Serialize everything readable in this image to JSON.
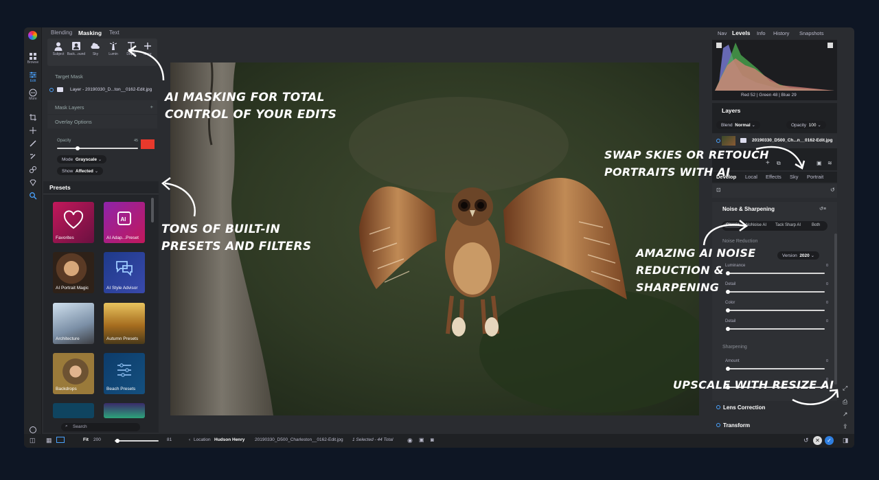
{
  "left_tabs": [
    "Blending",
    "Masking",
    "Text"
  ],
  "rail": {
    "browse": "Browse",
    "edit": "Edit",
    "more": "More"
  },
  "mask_tools": [
    "Subject",
    "Back...ound",
    "Sky",
    "Lumin",
    "Depth",
    "More"
  ],
  "target_mask": {
    "label": "Target Mask",
    "layer": "Layer - 20190330_D...ton__0162-Edit.jpg"
  },
  "mask_layers": "Mask Layers",
  "overlay_options": "Overlay Options",
  "opacity": {
    "label": "Opacity",
    "value": "45",
    "level": 0.45,
    "color": "#e8392c"
  },
  "mode": {
    "label": "Mode",
    "value": "Grayscale"
  },
  "show": {
    "label": "Show",
    "value": "Affected"
  },
  "presets": {
    "title": "Presets",
    "tiles": [
      "Favorites",
      "AI Adap...Preset",
      "AI Portrait Magic",
      "AI Style Advisor",
      "Architecture",
      "Autumn Presets",
      "Backdrops",
      "Beach Presets"
    ],
    "search_placeholder": "Search"
  },
  "right_tabs": [
    "Nav",
    "Levels",
    "Info",
    "History",
    "Snapshots"
  ],
  "histogram_readout": "Red  52  | Green  48  | Blue  29",
  "layers": {
    "title": "Layers",
    "blend_label": "Blend",
    "blend_value": "Normal",
    "opacity_label": "Opacity",
    "opacity_value": "100",
    "layer_name": "20190330_D500_Ch...n__0162-Edit.jpg"
  },
  "develop_tabs": [
    "Develop",
    "Local",
    "Effects",
    "Sky",
    "Portrait"
  ],
  "noise": {
    "title": "Noise & Sharpening",
    "modes": [
      "Classic",
      "NoNoise AI",
      "Tack Sharp AI",
      "Both"
    ],
    "reduction": "Noise Reduction",
    "version_label": "Version",
    "version": "2020",
    "sliders": [
      {
        "label": "Luminance",
        "value": "0"
      },
      {
        "label": "Detail",
        "value": "0"
      },
      {
        "label": "Color",
        "value": "0"
      },
      {
        "label": "Detail",
        "value": "0"
      }
    ],
    "sharpening": "Sharpening",
    "sharp_sliders": [
      {
        "label": "Amount",
        "value": "0"
      },
      {
        "label": "",
        "value": "0"
      }
    ]
  },
  "lens_correction": "Lens Correction",
  "transform": "Transform",
  "bottom": {
    "fit": "Fit",
    "zoom": "200",
    "zoom_right": "81",
    "location_label": "Location",
    "location": "Hudson Henry",
    "filename": "20190330_D500_Charleston__0162-Edit.jpg",
    "selection": "1 Selected - 44 Total"
  },
  "annotations": {
    "masking": [
      "AI Masking for total",
      "control of your edits"
    ],
    "presets": [
      "Tons of built-in",
      "presets and filters"
    ],
    "skies": [
      "Swap skies or retouch",
      "portraits with AI"
    ],
    "noise": [
      "Amazing AI Noise",
      "Reduction &",
      "Sharpening"
    ],
    "upscale": "Upscale with Resize AI"
  }
}
